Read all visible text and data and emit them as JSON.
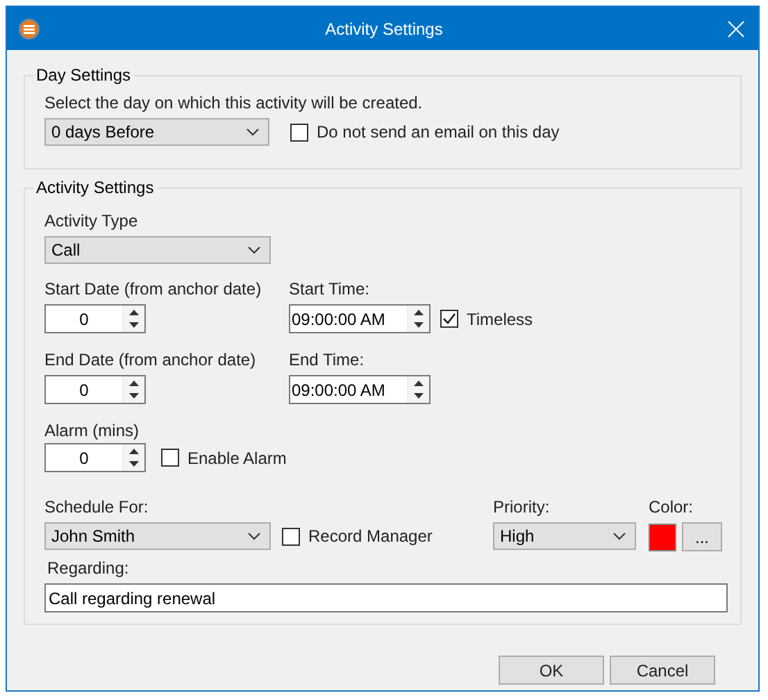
{
  "window": {
    "title": "Activity Settings"
  },
  "day_settings": {
    "legend": "Day Settings",
    "prompt": "Select the day on which this activity will be created.",
    "day": {
      "value": "0 days Before"
    },
    "no_email": {
      "label": "Do not send an email on this day",
      "checked": false
    }
  },
  "activity_settings": {
    "legend": "Activity Settings",
    "activity_type": {
      "label": "Activity Type",
      "value": "Call"
    },
    "start_date": {
      "label": "Start Date (from anchor date)",
      "value": "0"
    },
    "start_time": {
      "label": "Start Time:",
      "value": "09:00:00 AM"
    },
    "timeless": {
      "label": "Timeless",
      "checked": true
    },
    "end_date": {
      "label": "End Date (from anchor date)",
      "value": "0"
    },
    "end_time": {
      "label": "End Time:",
      "value": "09:00:00 AM"
    },
    "alarm": {
      "label": "Alarm (mins)",
      "value": "0"
    },
    "enable_alarm": {
      "label": "Enable Alarm",
      "checked": false
    },
    "schedule_for": {
      "label": "Schedule For:",
      "value": "John Smith"
    },
    "record_manager": {
      "label": "Record Manager",
      "checked": false
    },
    "priority": {
      "label": "Priority:",
      "value": "High"
    },
    "color": {
      "label": "Color:",
      "color": "#ff0000"
    },
    "color_button": "...",
    "regarding": {
      "label": "Regarding:",
      "value": "Call regarding renewal"
    }
  },
  "buttons": [
    {
      "label": "OK"
    },
    {
      "label": "Cancel"
    }
  ]
}
